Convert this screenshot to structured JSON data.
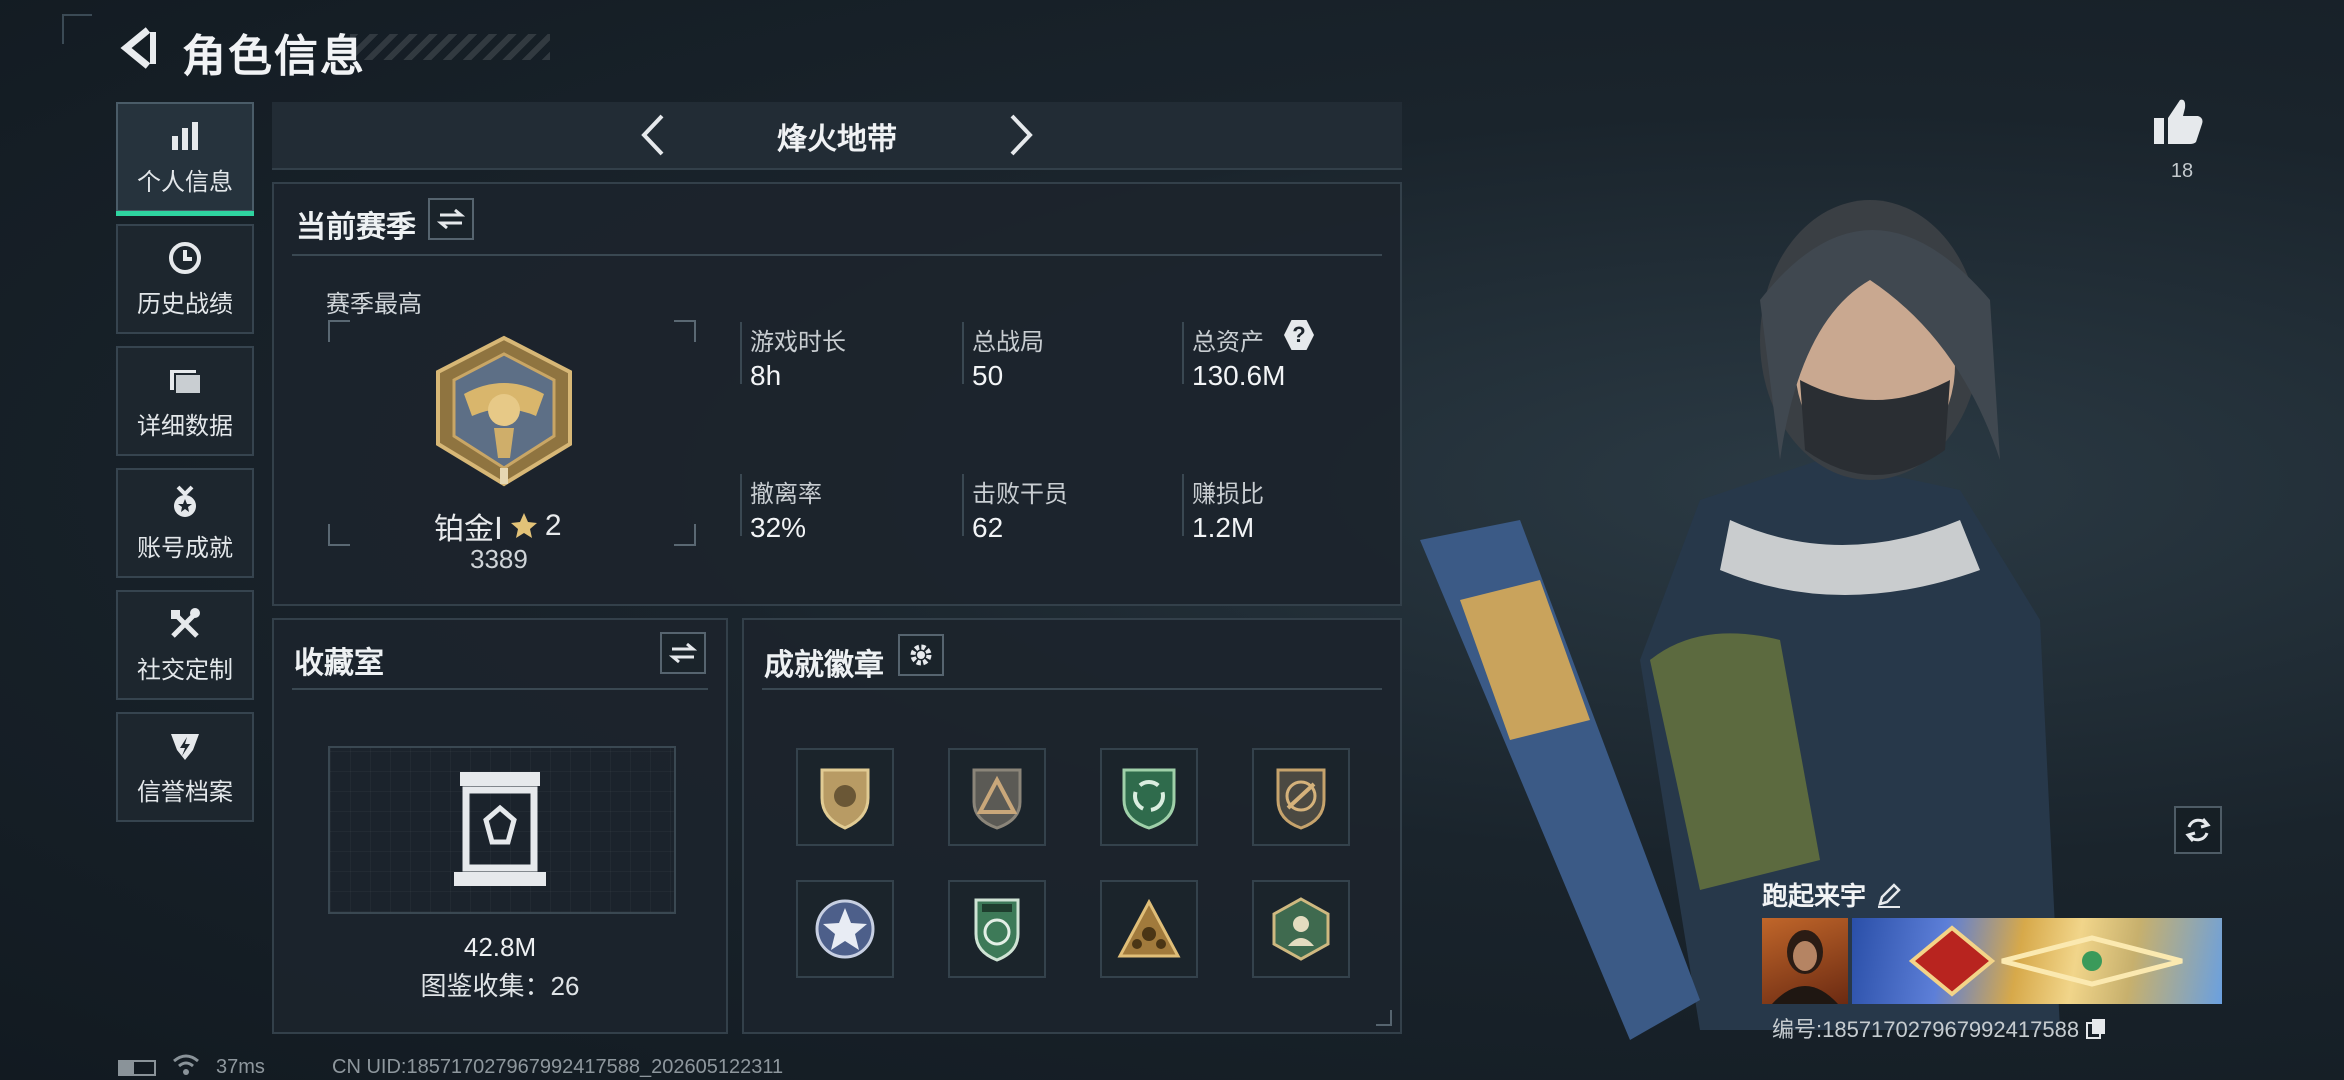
{
  "header": {
    "title": "角色信息"
  },
  "sidebar": {
    "items": [
      {
        "label": "个人信息",
        "icon": "bar-chart-icon",
        "active": true
      },
      {
        "label": "历史战绩",
        "icon": "history-clock-icon"
      },
      {
        "label": "详细数据",
        "icon": "folder-icon"
      },
      {
        "label": "账号成就",
        "icon": "medal-icon"
      },
      {
        "label": "社交定制",
        "icon": "tools-icon"
      },
      {
        "label": "信誉档案",
        "icon": "shield-bolt-icon"
      }
    ]
  },
  "mode": {
    "title": "烽火地带"
  },
  "season": {
    "title": "当前赛季",
    "best_label": "赛季最高",
    "rank_name": "铂金Ⅰ",
    "rank_stars": "2",
    "rank_score": "3389",
    "stats": [
      {
        "label": "游戏时长",
        "value": "8h"
      },
      {
        "label": "总战局",
        "value": "50"
      },
      {
        "label": "总资产",
        "value": "130.6M",
        "help": "?"
      },
      {
        "label": "撤离率",
        "value": "32%"
      },
      {
        "label": "击败干员",
        "value": "62"
      },
      {
        "label": "赚损比",
        "value": "1.2M"
      }
    ]
  },
  "collection": {
    "title": "收藏室",
    "value": "42.8M",
    "count_label": "图鉴收集：26"
  },
  "badges": {
    "title": "成就徽章",
    "count": 8
  },
  "profile": {
    "likes": "18",
    "nickname": "跑起来宇",
    "id_label": "编号:185717027967992417588"
  },
  "status_bar": {
    "ping": "37ms",
    "uid": "CN UID:185717027967992417588_202605122311"
  },
  "colors": {
    "accent": "#2fd4a0",
    "panel": "#1c242c",
    "border": "#33404a"
  }
}
